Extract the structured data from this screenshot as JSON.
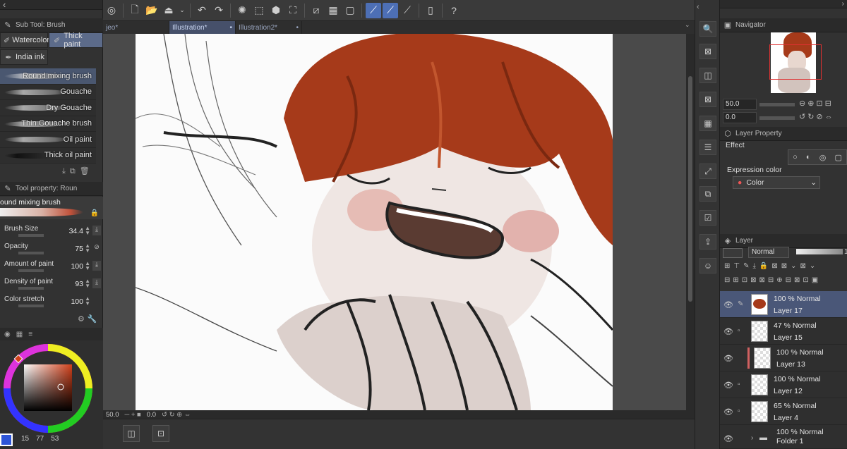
{
  "left": {
    "subtool_header": "Sub Tool: Brush",
    "tabs": [
      "Watercolor",
      "Thick paint",
      "India ink"
    ],
    "brushes": [
      "Round mixing brush",
      "Gouache",
      "Dry Gouache",
      "Thin Gouache brush",
      "Oil paint",
      "Thick oil paint"
    ],
    "toolprop_header": "Tool property: Roun",
    "current_brush": "ound mixing brush",
    "props": [
      {
        "label": "Brush Size",
        "value": "34.4"
      },
      {
        "label": "Opacity",
        "value": "75"
      },
      {
        "label": "Amount of paint",
        "value": "100"
      },
      {
        "label": "Density of paint",
        "value": "93"
      },
      {
        "label": "Color stretch",
        "value": "100"
      }
    ],
    "color_values": [
      "15",
      "77",
      "53"
    ]
  },
  "doc_tabs": [
    "jeo*",
    "Illustration*",
    "Illustration2*"
  ],
  "status": {
    "zoom": "50.0",
    "angle": "0.0"
  },
  "navigator": {
    "title": "Navigator",
    "zoom_value": "50.0",
    "rotate_value": "0.0"
  },
  "layer_property": {
    "title": "Layer Property",
    "effect_label": "Effect",
    "expression_label": "Expression color",
    "expression_value": "Color"
  },
  "layer_panel": {
    "title": "Layer",
    "blend_mode": "Normal",
    "opacity_readout": "1",
    "layers": [
      {
        "mode": "100 % Normal",
        "name": "Layer 17"
      },
      {
        "mode": "47 % Normal",
        "name": "Layer 15"
      },
      {
        "mode": "100 % Normal",
        "name": "Layer 13"
      },
      {
        "mode": "100 % Normal",
        "name": "Layer 12"
      },
      {
        "mode": "65 % Normal",
        "name": "Layer 4"
      },
      {
        "mode": "100 % Normal",
        "name": "Folder 1"
      }
    ]
  },
  "colors": {
    "accent": "#4d6fb5",
    "hair": "#a63a1a",
    "selected_layer": "#4a5778"
  },
  "icons": [
    "undo-icon",
    "redo-icon",
    "eye-icon",
    "lock-icon",
    "folder-icon",
    "color-wheel-icon"
  ]
}
